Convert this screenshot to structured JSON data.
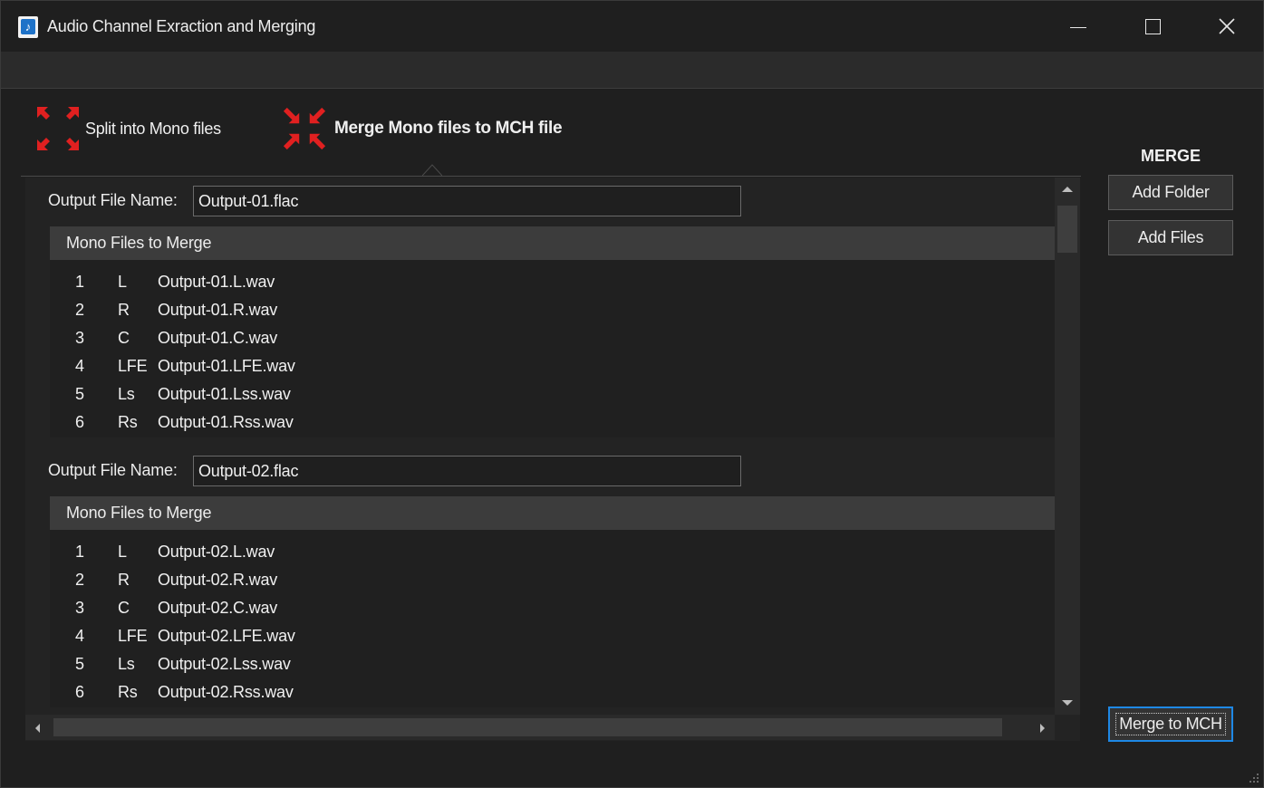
{
  "window": {
    "title": "Audio Channel Exraction and Merging",
    "icon": "music-note-icon",
    "controls": [
      "minimize-icon",
      "maximize-icon",
      "close-icon"
    ]
  },
  "tabs": [
    {
      "label": "Split into Mono files",
      "icon": "expand-arrows-icon",
      "active": false
    },
    {
      "label": "Merge Mono files to MCH file",
      "icon": "collapse-arrows-icon",
      "active": true
    }
  ],
  "colors": {
    "accent": "#1e88e5",
    "tab_icon": "#e02020",
    "background": "#1f1f1f"
  },
  "groups": [
    {
      "output_label": "Output File Name:",
      "output_value": "Output-01.flac",
      "list_header": "Mono Files to Merge",
      "rows": [
        {
          "idx": "1",
          "ch": "L",
          "file": "Output-01.L.wav"
        },
        {
          "idx": "2",
          "ch": "R",
          "file": "Output-01.R.wav"
        },
        {
          "idx": "3",
          "ch": "C",
          "file": "Output-01.C.wav"
        },
        {
          "idx": "4",
          "ch": "LFE",
          "file": "Output-01.LFE.wav"
        },
        {
          "idx": "5",
          "ch": "Ls",
          "file": "Output-01.Lss.wav"
        },
        {
          "idx": "6",
          "ch": "Rs",
          "file": "Output-01.Rss.wav"
        }
      ]
    },
    {
      "output_label": "Output File Name:",
      "output_value": "Output-02.flac",
      "list_header": "Mono Files to Merge",
      "rows": [
        {
          "idx": "1",
          "ch": "L",
          "file": "Output-02.L.wav"
        },
        {
          "idx": "2",
          "ch": "R",
          "file": "Output-02.R.wav"
        },
        {
          "idx": "3",
          "ch": "C",
          "file": "Output-02.C.wav"
        },
        {
          "idx": "4",
          "ch": "LFE",
          "file": "Output-02.LFE.wav"
        },
        {
          "idx": "5",
          "ch": "Ls",
          "file": "Output-02.Lss.wav"
        },
        {
          "idx": "6",
          "ch": "Rs",
          "file": "Output-02.Rss.wav"
        }
      ]
    }
  ],
  "side": {
    "title": "MERGE",
    "add_folder": "Add Folder",
    "add_files": "Add Files",
    "merge_to_mch": "Merge to MCH"
  }
}
